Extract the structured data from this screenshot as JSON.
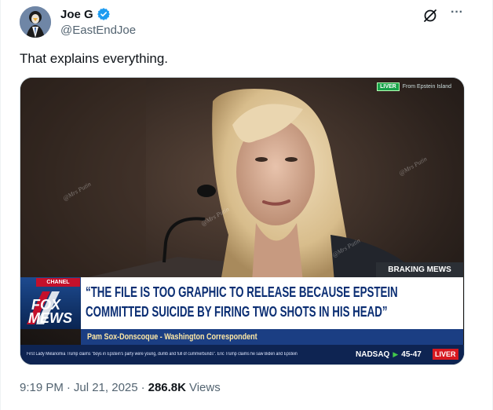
{
  "author": {
    "display_name": "Joe G",
    "handle": "@EastEndJoe",
    "verified": true
  },
  "icons": {
    "verified": "verified-badge-icon",
    "grok": "grok-icon",
    "more": "more-icon"
  },
  "more_label": "···",
  "tweet": {
    "text": "That explains everything."
  },
  "media": {
    "top_live_pill": "LIVER",
    "top_live_text": "From Epstein Island",
    "watermark": "@Mrs Putin",
    "breaking_label": "BRAKING MEWS",
    "channel_tag": "CHANEL",
    "logo_line1": "FOX",
    "logo_line2": "MEWS",
    "headline_line1": "“THE FILE IS TOO GRAPHIC TO RELEASE BECAUSE EPSTEIN",
    "headline_line2": "COMMITTED SUICIDE BY FIRING TWO SHOTS IN HIS HEAD”",
    "subtitle": "Pam Sox-Donscoque - Washington Correspondent",
    "ticker": "First Lady Melanomia Trump claims \"boys in Epstein's party were young, dumb and full of cummerbunds\".  Eric Trump claims he saw Biden and Epstein",
    "index_name": "NADSAQ",
    "index_value": "45-47",
    "live_badge": "LIVER"
  },
  "meta": {
    "time": "9:19 PM",
    "date": "Jul 21, 2025",
    "separator": "·",
    "views_count": "286.8K",
    "views_label": "Views"
  },
  "colors": {
    "brand_blue": "#1d9bf0",
    "headline_blue": "#0b2e73",
    "chyron_red": "#c4102b",
    "ticker_navy": "#0e2452"
  }
}
